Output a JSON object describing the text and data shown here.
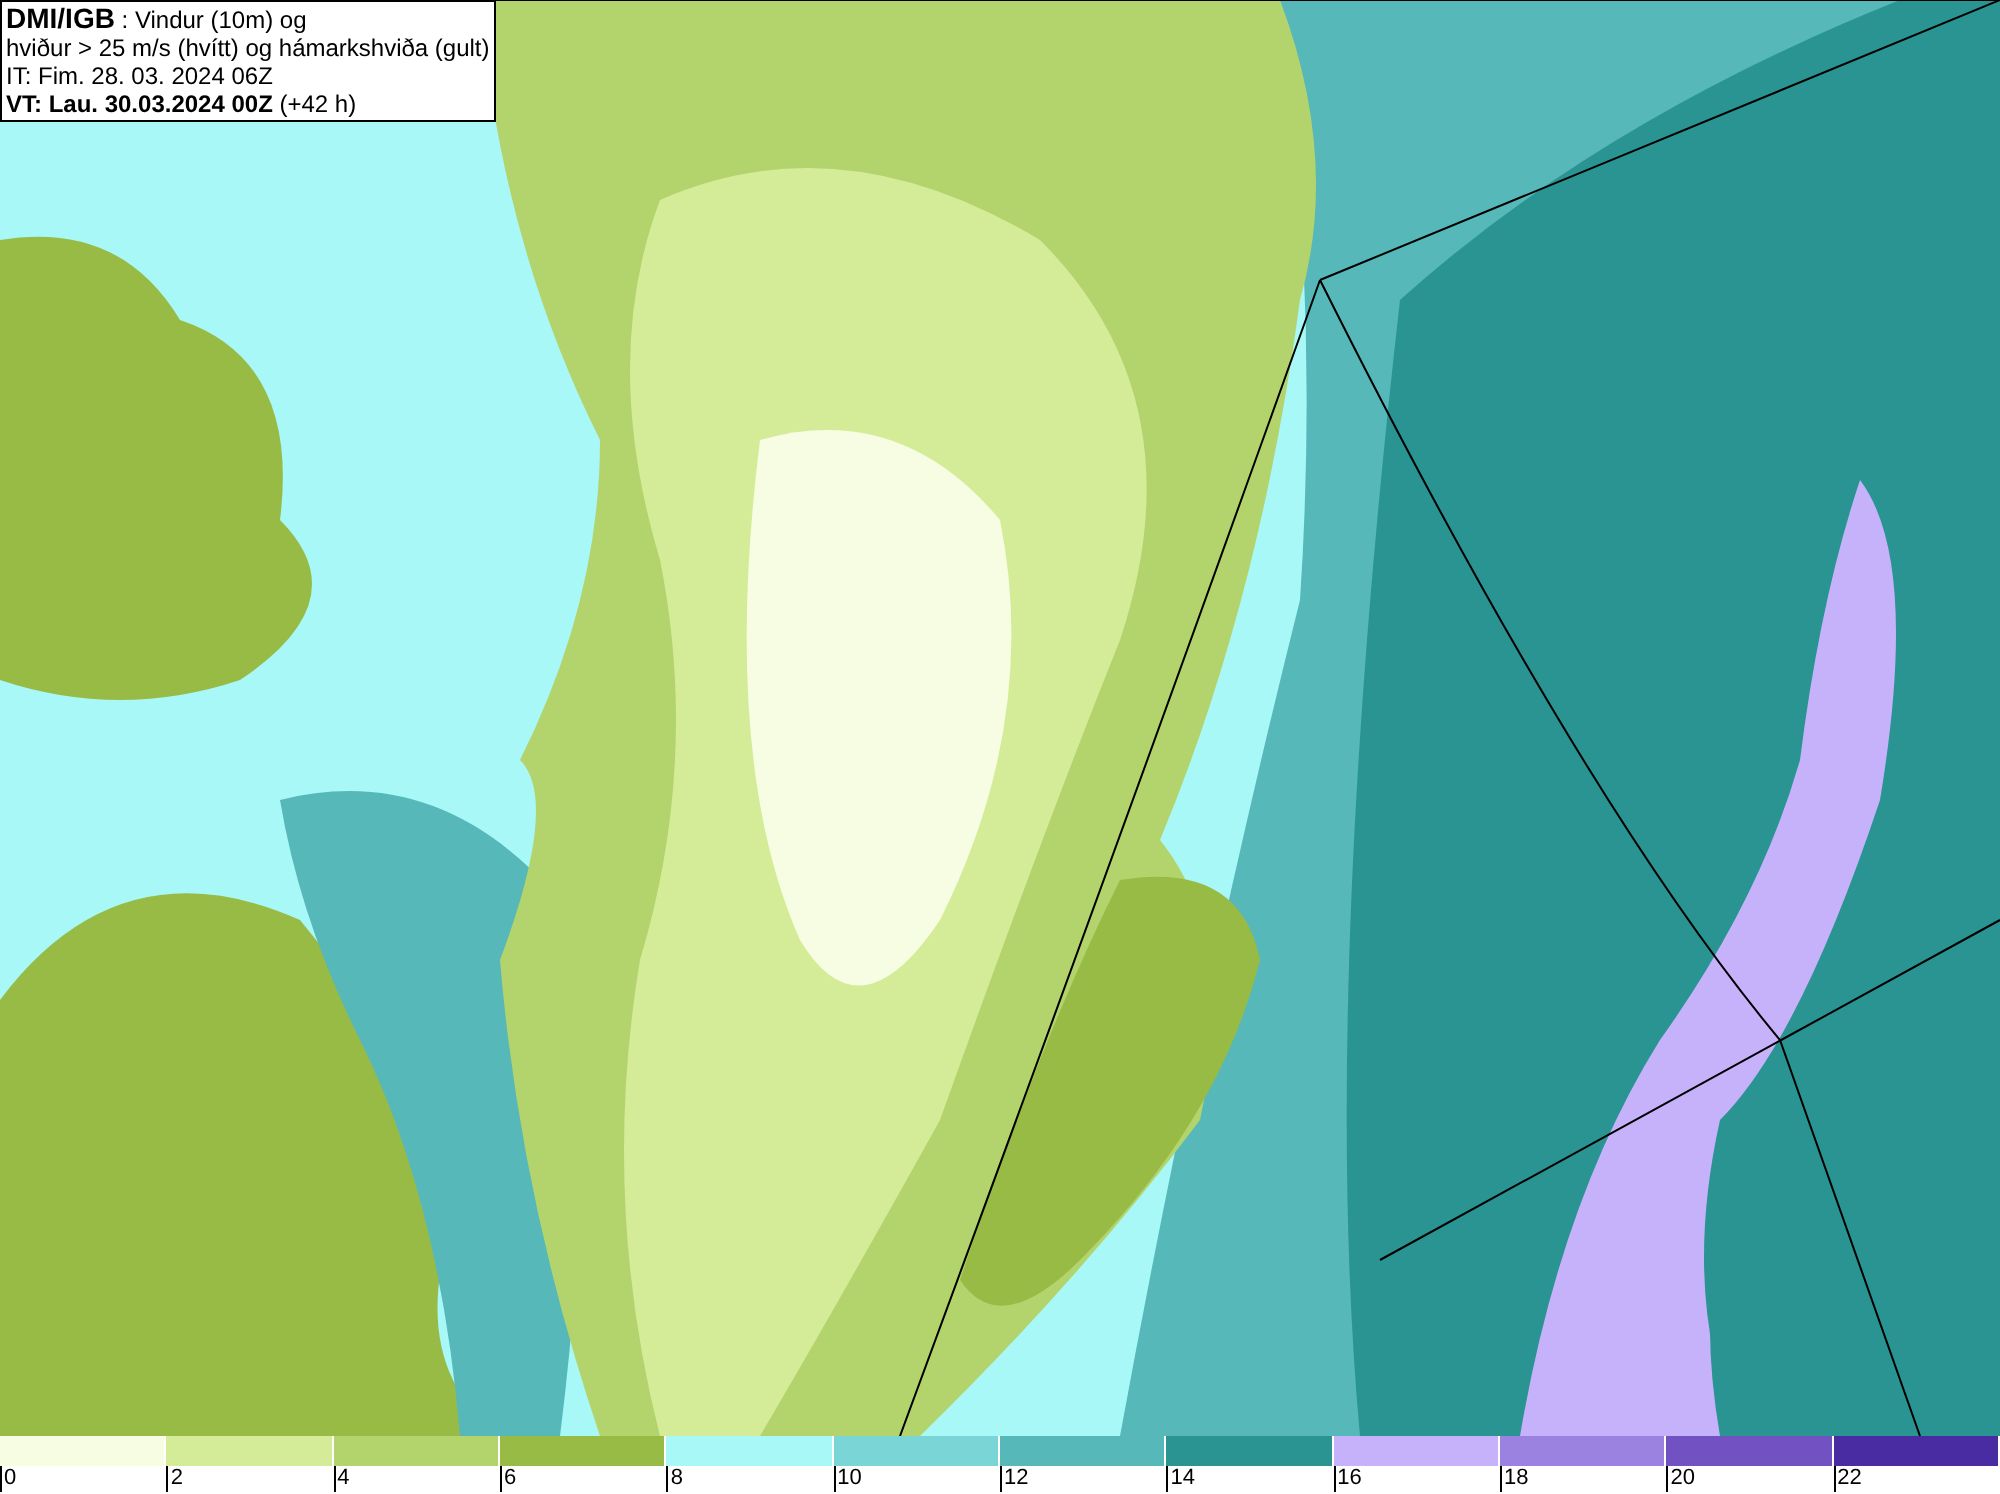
{
  "header": {
    "lines": [
      "**DMI/IGB** : Vindur (10m) og",
      "hviður > 25 m/s (hvítt) og hámarkshviða (gult)",
      "IT: Fim. 28. 03. 2024 06Z",
      "**VT: Lau. 30.03.2024 00Z** (+42 h)"
    ]
  },
  "legend": [
    {
      "label": "0",
      "color": "#f6fde2"
    },
    {
      "label": "2",
      "color": "#d4ec98"
    },
    {
      "label": "4",
      "color": "#b3d46c"
    },
    {
      "label": "6",
      "color": "#98bb46"
    },
    {
      "label": "8",
      "color": "#a8f8f8"
    },
    {
      "label": "10",
      "color": "#7ad6d6"
    },
    {
      "label": "12",
      "color": "#56b8b8"
    },
    {
      "label": "14",
      "color": "#2a9492"
    },
    {
      "label": "16",
      "color": "#c6b2fa"
    },
    {
      "label": "18",
      "color": "#9c82e0"
    },
    {
      "label": "20",
      "color": "#7252c2"
    },
    {
      "label": "22",
      "color": "#4a2ca2"
    }
  ]
}
